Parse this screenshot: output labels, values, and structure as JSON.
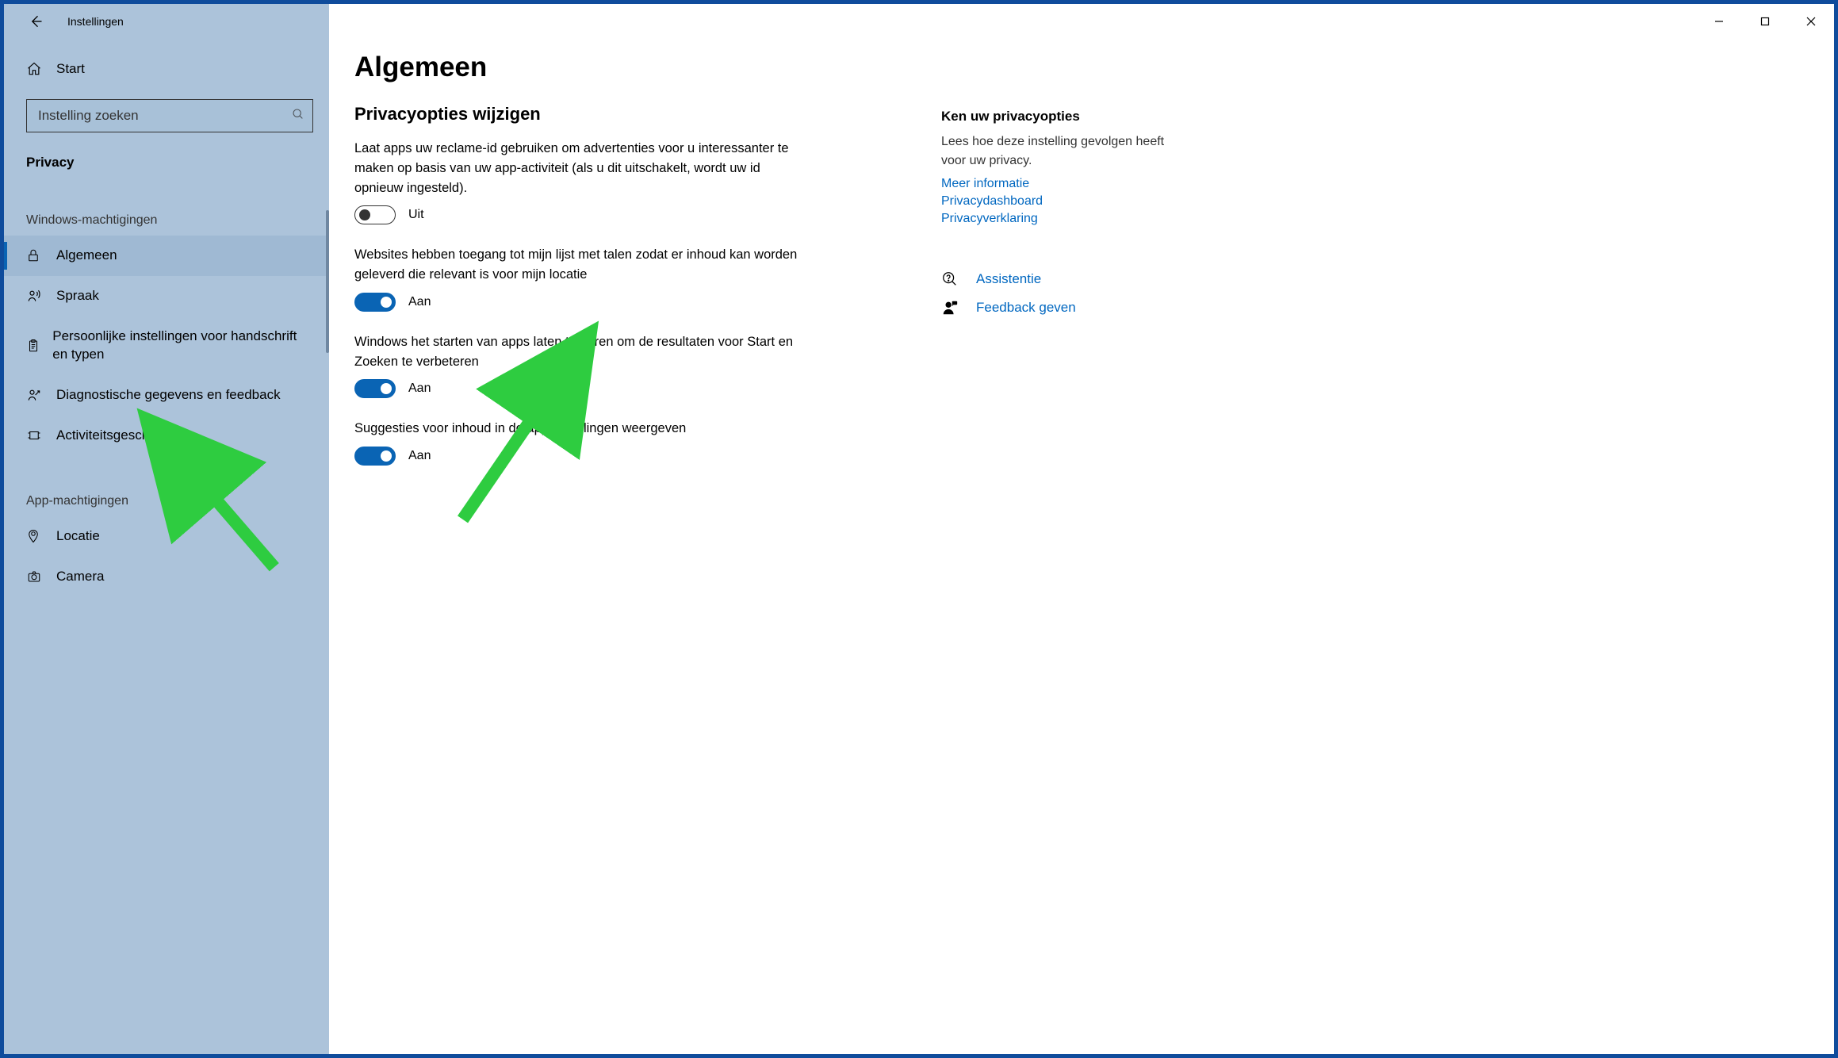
{
  "window": {
    "title": "Instellingen"
  },
  "sidebar": {
    "home_label": "Start",
    "search_placeholder": "Instelling zoeken",
    "category_label": "Privacy",
    "group1_label": "Windows-machtigingen",
    "group2_label": "App-machtigingen",
    "items": [
      {
        "label": "Algemeen"
      },
      {
        "label": "Spraak"
      },
      {
        "label": "Persoonlijke instellingen voor handschrift en typen"
      },
      {
        "label": "Diagnostische gegevens en feedback"
      },
      {
        "label": "Activiteitsgeschiedenis"
      }
    ],
    "app_items": [
      {
        "label": "Locatie"
      },
      {
        "label": "Camera"
      }
    ]
  },
  "main": {
    "page_title": "Algemeen",
    "section_title": "Privacyopties wijzigen",
    "settings": [
      {
        "desc": "Laat apps uw reclame-id gebruiken om advertenties voor u interessanter te maken op basis van uw app-activiteit (als u dit uitschakelt, wordt uw id opnieuw ingesteld).",
        "on": false,
        "state_label": "Uit"
      },
      {
        "desc": "Websites hebben toegang tot mijn lijst met talen zodat er inhoud kan worden geleverd die relevant is voor mijn locatie",
        "on": true,
        "state_label": "Aan"
      },
      {
        "desc": "Windows het starten van apps laten traceren om de resultaten voor Start en Zoeken te verbeteren",
        "on": true,
        "state_label": "Aan"
      },
      {
        "desc": "Suggesties voor inhoud in de app Instellingen weergeven",
        "on": true,
        "state_label": "Aan"
      }
    ]
  },
  "aside": {
    "heading": "Ken uw privacyopties",
    "text": "Lees hoe deze instelling gevolgen heeft voor uw privacy.",
    "links": [
      "Meer informatie",
      "Privacydashboard",
      "Privacyverklaring"
    ],
    "actions": [
      {
        "label": "Assistentie"
      },
      {
        "label": "Feedback geven"
      }
    ]
  }
}
